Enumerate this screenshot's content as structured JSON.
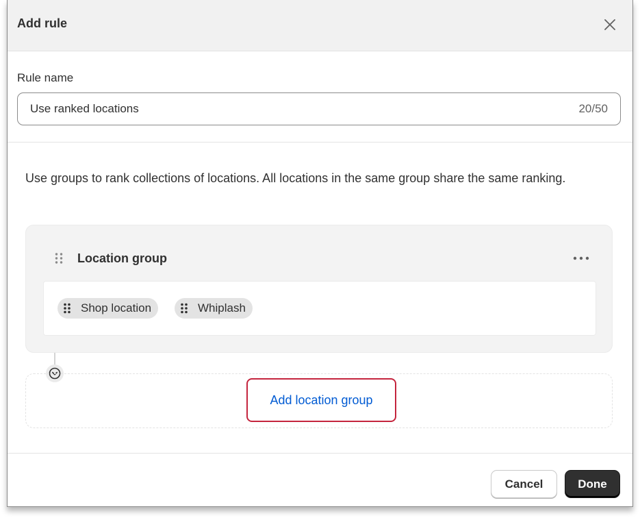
{
  "modal": {
    "title": "Add rule"
  },
  "rule_name": {
    "label": "Rule name",
    "value": "Use ranked locations",
    "char_count": "20/50"
  },
  "description": "Use groups to rank collections of locations. All locations in the same group share the same ranking.",
  "location_group": {
    "title": "Location group",
    "locations": [
      "Shop location",
      "Whiplash"
    ]
  },
  "add_group_label": "Add location group",
  "footer": {
    "cancel_label": "Cancel",
    "done_label": "Done"
  },
  "icons": {
    "close": "close-icon",
    "drag": "drag-handle-icon",
    "more": "more-horizontal-icon",
    "chevron": "chevron-down-circle-icon"
  },
  "colors": {
    "header_bg": "#f1f1f1",
    "link": "#005bd3",
    "highlight_border": "#c4243d",
    "primary_button": "#303030"
  }
}
